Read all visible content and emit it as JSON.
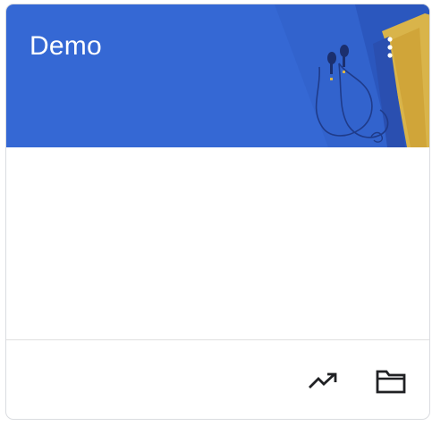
{
  "card": {
    "title": "Demo"
  },
  "icons": {
    "more": "more-vert-icon",
    "trend": "trending-up-icon",
    "folder": "folder-icon"
  },
  "colors": {
    "banner": "#3568d4",
    "banner_shadow": "#2a4fb0",
    "book_gold": "#d9b44a",
    "icon_dark": "#202124"
  }
}
